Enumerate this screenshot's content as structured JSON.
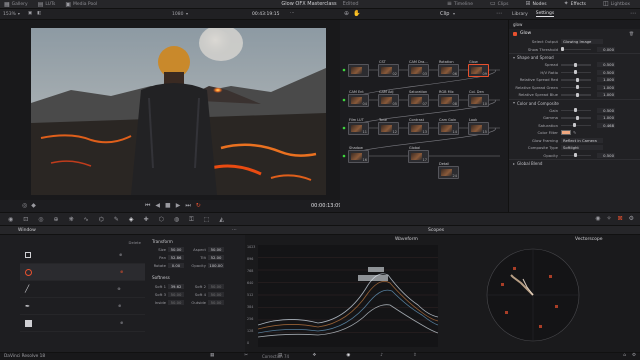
{
  "topbar": {
    "items": [
      "Gallery",
      "LUTs",
      "Media Pool"
    ],
    "title": "Glow OFX Masterclass",
    "subtitle": "Edited",
    "right": [
      "Timeline",
      "Clips",
      "Nodes",
      "Effects",
      "Lightbox"
    ]
  },
  "viewer": {
    "zoom": "153%",
    "clip_name": "1080",
    "timecode_top": "00:43:19:15",
    "timecode": "00:00:13:09"
  },
  "nodeeditor": {
    "mode": "Clip",
    "nodes": [
      {
        "label": "CST",
        "num": "02"
      },
      {
        "label": "CAM Dra...",
        "num": "03"
      },
      {
        "label": "Rotation",
        "num": "06"
      },
      {
        "label": "Glow",
        "num": "09"
      },
      {
        "label": "CAM Ent",
        "num": "04"
      },
      {
        "label": "CAM Adj",
        "num": "05"
      },
      {
        "label": "Saturation",
        "num": "07"
      },
      {
        "label": "RGB Mix",
        "num": "08"
      },
      {
        "label": "Col. Den",
        "num": "10"
      },
      {
        "label": "Film LUT",
        "num": "11"
      },
      {
        "label": "Tone",
        "num": "12"
      },
      {
        "label": "Contrast",
        "num": "13"
      },
      {
        "label": "Cam Gain",
        "num": "14"
      },
      {
        "label": "Look",
        "num": "15"
      },
      {
        "label": "Shadow",
        "num": "16"
      },
      {
        "label": "Global",
        "num": "17"
      },
      {
        "label": "Detail",
        "num": "24"
      }
    ]
  },
  "inspector": {
    "tabs": [
      "Library",
      "Settings"
    ],
    "search": "glow",
    "effect": "Glow",
    "select_output_label": "Select Output",
    "select_output_value": "Glowing Image",
    "rows_top": [
      {
        "label": "Show Threshold",
        "value": "0.000"
      }
    ],
    "section_shape": "Shape and Spread",
    "rows_shape": [
      {
        "label": "Spread",
        "value": "0.500"
      },
      {
        "label": "H/V Ratio",
        "value": "0.500"
      },
      {
        "label": "Relative Spread Red",
        "value": "1.000"
      },
      {
        "label": "Relative Spread Green",
        "value": "1.000"
      },
      {
        "label": "Relative Spread Blue",
        "value": "1.000"
      }
    ],
    "section_color": "Color and Composite",
    "rows_color": [
      {
        "label": "Gain",
        "value": "0.500"
      },
      {
        "label": "Gamma",
        "value": "1.000"
      },
      {
        "label": "Saturation",
        "value": "0.468"
      }
    ],
    "color_filter_label": "Color Filter",
    "color_filter_hex": "#f0a880",
    "glow_framing_label": "Glow Framing",
    "glow_framing_value": "Reflect in Camera",
    "composite_type_label": "Composite Type",
    "composite_type_value": "Softlight",
    "opacity_label": "Opacity",
    "opacity_value": "0.500",
    "section_global": "Global Blend"
  },
  "window": {
    "title": "Window",
    "delete_label": "Delete",
    "transform_title": "Transform",
    "transform": [
      {
        "k": "Size",
        "v": "50.00",
        "k2": "Aspect",
        "v2": "50.00"
      },
      {
        "k": "Pan",
        "v": "52.86",
        "k2": "Tilt",
        "v2": "52.00"
      },
      {
        "k": "Rotate",
        "v": "0.00",
        "k2": "Opacity",
        "v2": "100.00"
      }
    ],
    "softness_title": "Softness",
    "softness": [
      {
        "k": "Soft 1",
        "v": "39.62",
        "k2": "Soft 2",
        "v2": "50.00"
      },
      {
        "k": "Soft 3",
        "v": "50.00",
        "k2": "Soft 4",
        "v2": "50.00"
      },
      {
        "k": "Inside",
        "v": "50.00",
        "k2": "Outside",
        "v2": "50.00"
      }
    ]
  },
  "scopes": {
    "title": "Scopes",
    "waveform": "Waveform",
    "vectorscope": "Vectorscope",
    "scale": [
      "1023",
      "896",
      "768",
      "640",
      "512",
      "384",
      "256",
      "128",
      "0"
    ]
  },
  "bottombar": {
    "app": "DaVinci Resolve 18",
    "timeline_label": "Correction 74"
  },
  "colors": {
    "accent": "#e8512f",
    "panel": "#212124"
  }
}
